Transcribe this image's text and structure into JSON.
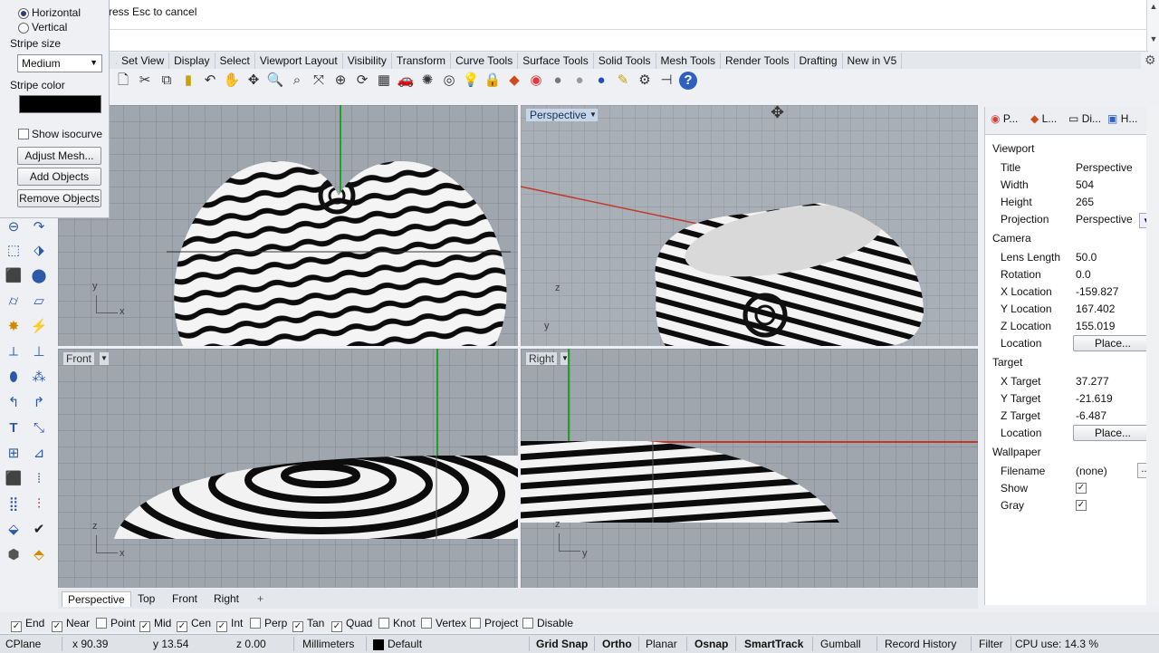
{
  "command": {
    "history_line": "ress Esc to cancel",
    "prompt": ""
  },
  "tabs": [
    "Set View",
    "Display",
    "Select",
    "Viewport Layout",
    "Visibility",
    "Transform",
    "Curve Tools",
    "Surface Tools",
    "Solid Tools",
    "Mesh Tools",
    "Render Tools",
    "Drafting",
    "New in V5"
  ],
  "toolbar_icons": [
    "new-icon",
    "cut-icon",
    "copy-icon",
    "paste-icon",
    "undo-icon",
    "pan-icon",
    "move-view-icon",
    "zoom-icon",
    "zoom-window-icon",
    "zoom-extents-icon",
    "zoom-selected-icon",
    "rotate-view-icon",
    "grid-icon",
    "car-icon",
    "render-icon",
    "target-icon",
    "light-icon",
    "lock-icon",
    "layer-icon",
    "color-wheel-icon",
    "material-sphere-icon",
    "grey-sphere-icon",
    "blue-sphere-icon",
    "options-icon",
    "gear-icon",
    "snap-icon",
    "help-icon"
  ],
  "stripe_panel": {
    "horizontal": "Horizontal",
    "vertical": "Vertical",
    "stripe_size_label": "Stripe size",
    "stripe_size_value": "Medium",
    "stripe_color_label": "Stripe color",
    "stripe_color": "#000000",
    "show_isocurve": "Show isocurve",
    "adjust_mesh": "Adjust Mesh...",
    "add_objects": "Add Objects",
    "remove_objects": "Remove Objects"
  },
  "viewports": {
    "top": {
      "x_axis": "x",
      "y_axis": "y"
    },
    "perspective": {
      "label": "Perspective",
      "z_axis": "z",
      "y_axis": "y"
    },
    "front": {
      "label": "Front",
      "z_axis": "z",
      "x_axis": "x"
    },
    "right": {
      "label": "Right",
      "z_axis": "z",
      "y_axis": "y"
    }
  },
  "viewport_tabs": [
    "Perspective",
    "Top",
    "Front",
    "Right",
    "+"
  ],
  "osnaps": [
    {
      "label": "End",
      "checked": true
    },
    {
      "label": "Near",
      "checked": true
    },
    {
      "label": "Point",
      "checked": false
    },
    {
      "label": "Mid",
      "checked": true
    },
    {
      "label": "Cen",
      "checked": true
    },
    {
      "label": "Int",
      "checked": true
    },
    {
      "label": "Perp",
      "checked": false
    },
    {
      "label": "Tan",
      "checked": true
    },
    {
      "label": "Quad",
      "checked": true
    },
    {
      "label": "Knot",
      "checked": false
    },
    {
      "label": "Vertex",
      "checked": false
    },
    {
      "label": "Project",
      "checked": false
    },
    {
      "label": "Disable",
      "checked": false
    }
  ],
  "status": {
    "cplane": "CPlane",
    "x": "x 90.39",
    "y": "y 13.54",
    "z": "z 0.00",
    "units": "Millimeters",
    "layer": "Default",
    "grid_snap": "Grid Snap",
    "ortho": "Ortho",
    "planar": "Planar",
    "osnap": "Osnap",
    "smarttrack": "SmartTrack",
    "gumball": "Gumball",
    "record_history": "Record History",
    "filter": "Filter",
    "cpu": "CPU use: 14.3 %"
  },
  "properties": {
    "tabs": [
      "P...",
      "L...",
      "Di...",
      "H..."
    ],
    "viewport_section": "Viewport",
    "title_label": "Title",
    "title_value": "Perspective",
    "width_label": "Width",
    "width_value": "504",
    "height_label": "Height",
    "height_value": "265",
    "projection_label": "Projection",
    "projection_value": "Perspective",
    "camera_section": "Camera",
    "lens_label": "Lens Length",
    "lens_value": "50.0",
    "rotation_label": "Rotation",
    "rotation_value": "0.0",
    "xloc_label": "X Location",
    "xloc_value": "-159.827",
    "yloc_label": "Y Location",
    "yloc_value": "167.402",
    "zloc_label": "Z Location",
    "zloc_value": "155.019",
    "location_label": "Location",
    "place_button": "Place...",
    "target_section": "Target",
    "xt_label": "X Target",
    "xt_value": "37.277",
    "yt_label": "Y Target",
    "yt_value": "-21.619",
    "zt_label": "Z Target",
    "zt_value": "-6.487",
    "wallpaper_section": "Wallpaper",
    "filename_label": "Filename",
    "filename_value": "(none)",
    "browse_button": "...",
    "show_label": "Show",
    "gray_label": "Gray"
  }
}
